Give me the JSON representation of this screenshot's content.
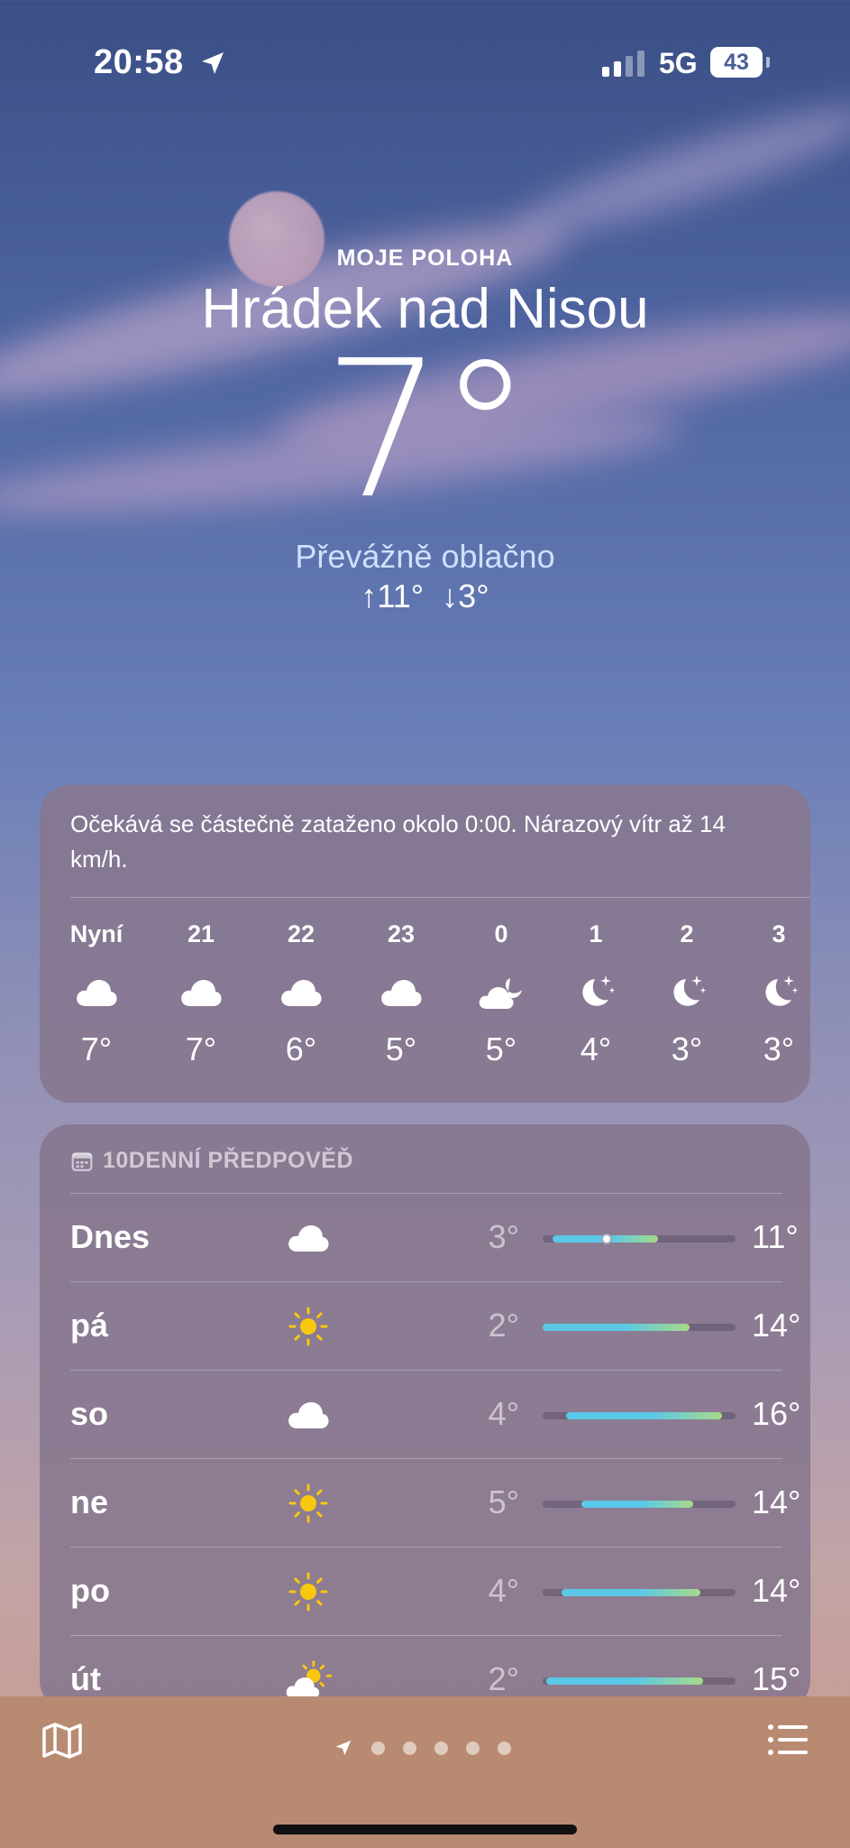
{
  "status_bar": {
    "time": "20:58",
    "network": "5G",
    "battery": "43"
  },
  "header": {
    "label": "MOJE POLOHA",
    "city": "Hrádek nad Nisou",
    "temperature": "7°",
    "condition": "Převážně oblačno",
    "high_low": "↑11° ↓3°"
  },
  "hourly": {
    "summary": "Očekává se částečně zataženo okolo 0:00. Nárazový vítr až 14 km/h.",
    "items": [
      {
        "label": "Nyní",
        "icon": "cloud-icon",
        "temp": "7°"
      },
      {
        "label": "21",
        "icon": "cloud-icon",
        "temp": "7°"
      },
      {
        "label": "22",
        "icon": "cloud-icon",
        "temp": "6°"
      },
      {
        "label": "23",
        "icon": "cloud-icon",
        "temp": "5°"
      },
      {
        "label": "0",
        "icon": "cloud-moon-icon",
        "temp": "5°"
      },
      {
        "label": "1",
        "icon": "moon-stars-icon",
        "temp": "4°"
      },
      {
        "label": "2",
        "icon": "moon-stars-icon",
        "temp": "3°"
      },
      {
        "label": "3",
        "icon": "moon-stars-icon",
        "temp": "3°"
      }
    ]
  },
  "forecast": {
    "title": "10DENNÍ PŘEDPOVĚĎ",
    "days": [
      {
        "day": "Dnes",
        "icon": "cloud-icon",
        "low": "3°",
        "high": "11°",
        "range_start": 0.05,
        "range_end": 0.6,
        "current": 0.33
      },
      {
        "day": "pá",
        "icon": "sun-icon",
        "low": "2°",
        "high": "14°",
        "range_start": 0.0,
        "range_end": 0.76
      },
      {
        "day": "so",
        "icon": "cloud-icon",
        "low": "4°",
        "high": "16°",
        "range_start": 0.12,
        "range_end": 0.93
      },
      {
        "day": "ne",
        "icon": "sun-icon",
        "low": "5°",
        "high": "14°",
        "range_start": 0.2,
        "range_end": 0.78
      },
      {
        "day": "po",
        "icon": "sun-icon",
        "low": "4°",
        "high": "14°",
        "range_start": 0.1,
        "range_end": 0.82
      },
      {
        "day": "út",
        "icon": "sun-cloud-icon",
        "low": "2°",
        "high": "15°",
        "range_start": 0.02,
        "range_end": 0.83
      }
    ]
  },
  "colors": {
    "bar_cool": "#5ac8e6",
    "bar_warm": "#a7d98a",
    "sun": "#f8c80e"
  },
  "bottom_bar": {
    "pages": 5
  }
}
